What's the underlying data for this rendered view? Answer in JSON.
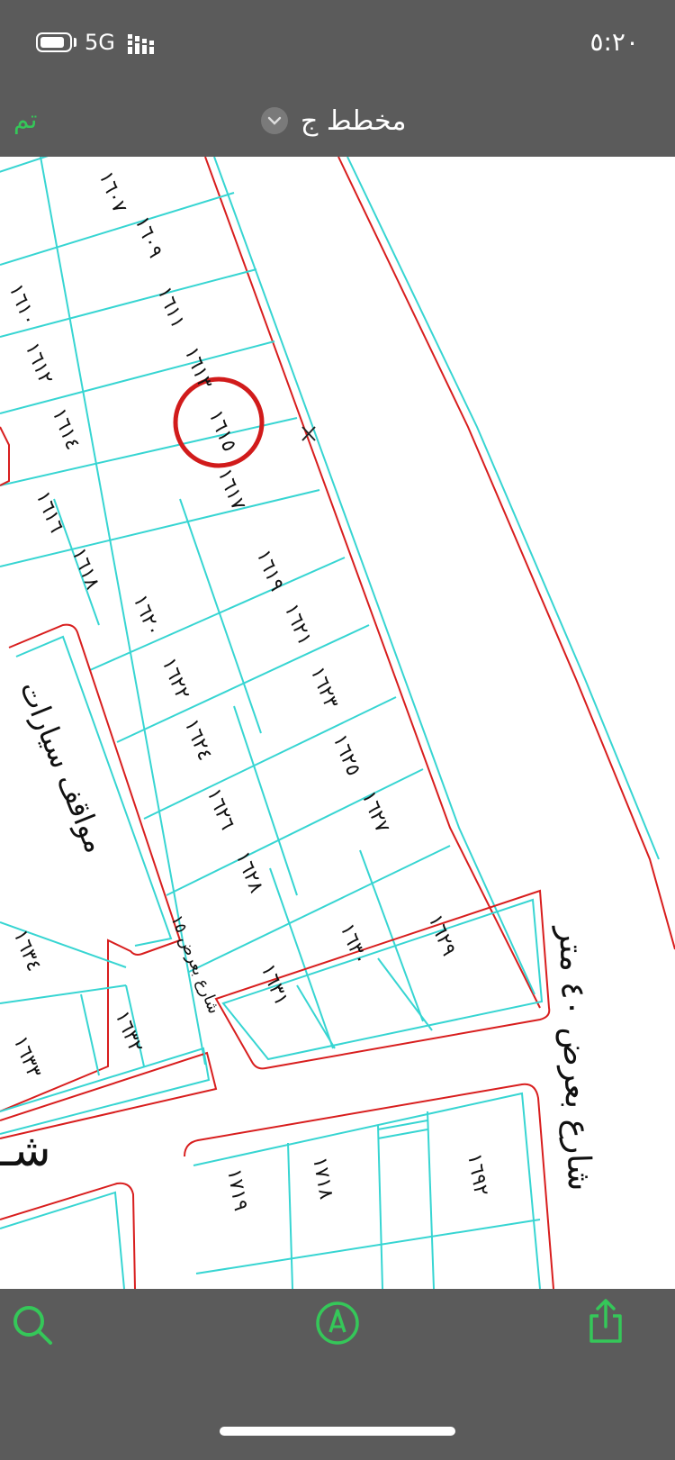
{
  "status": {
    "network": "5G",
    "time": "٥:٢٠"
  },
  "nav": {
    "done_label": "تم",
    "title": "مخطط ج"
  },
  "map": {
    "lots": [
      "١٦٠٧",
      "١٦٠٩",
      "١٦١٠",
      "١٦١١",
      "١٦١٢",
      "١٦١٣",
      "١٦١٤",
      "١٦١٥",
      "١٦١٦",
      "١٦١٧",
      "١٦١٨",
      "١٦١٩",
      "١٦٢٠",
      "١٦٢١",
      "١٦٢٢",
      "١٦٢٣",
      "١٦٢٤",
      "١٦٢٥",
      "١٦٢٦",
      "١٦٢٧",
      "١٦٢٨",
      "١٦٢٩",
      "١٦٣٠",
      "١٦٣١",
      "١٦٣٢",
      "١٦٣٣",
      "١٦٣٤",
      "١٦٩٢",
      "١٧١٨",
      "١٧١٩"
    ],
    "parking_label": "مواقف سيارات",
    "street_label": "شارع بعرض ١٥",
    "main_street_label": "شارع بعرض ٤٠ متر",
    "partial_label": "شـ",
    "marker": "X"
  },
  "colors": {
    "accent": "#35c759",
    "parcel_line": "#37d5d2",
    "boundary": "#d81e1e",
    "highlight": "#d11b1b"
  }
}
